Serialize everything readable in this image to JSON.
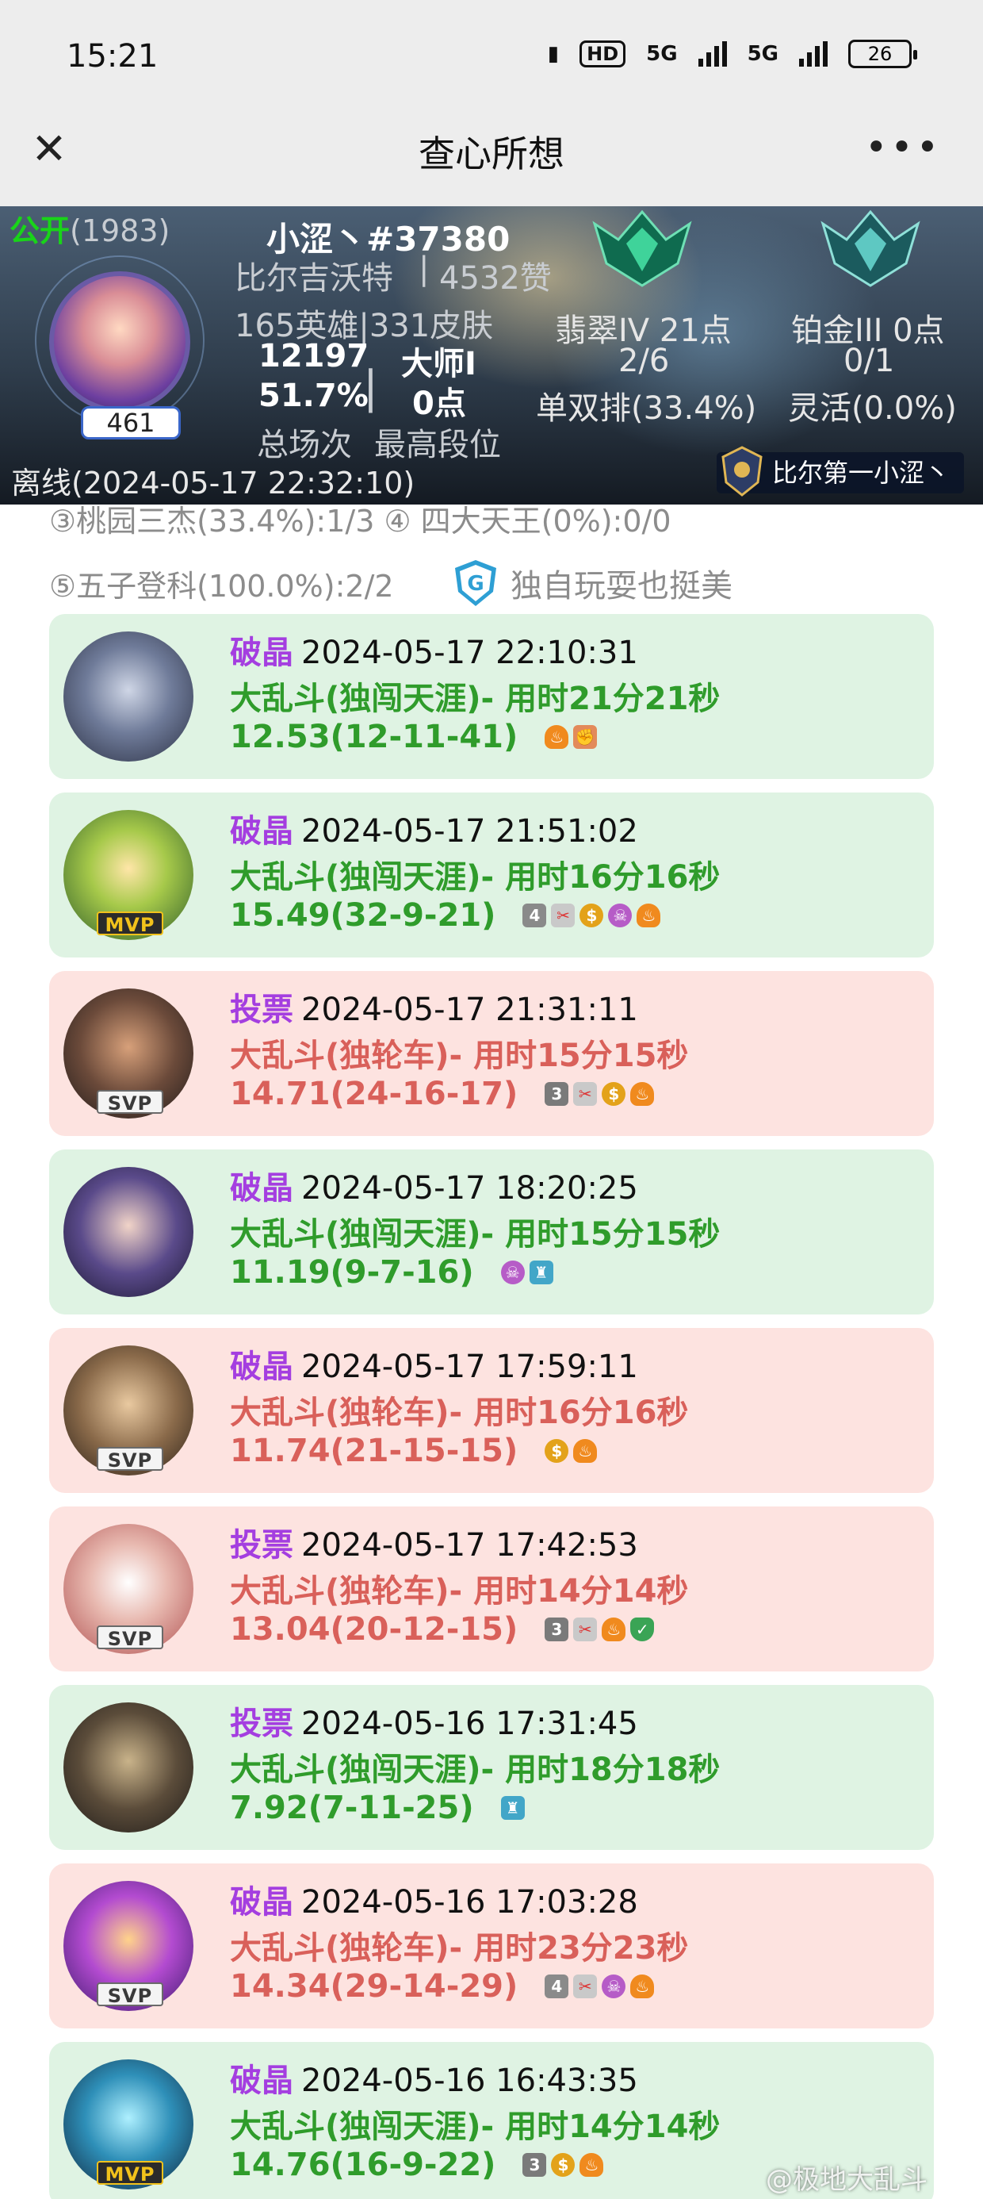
{
  "status_bar": {
    "time": "15:21",
    "icons": [
      "vibrate-icon",
      "hd-icon",
      "signal-5g-icon",
      "signal-5g-icon",
      "battery-icon"
    ],
    "hd_label": "HD",
    "net1": "5G",
    "net2": "5G",
    "battery": "26"
  },
  "title_bar": {
    "title": "查心所想",
    "close_icon": "✕",
    "more_icon": "•••"
  },
  "profile": {
    "visibility": "公开",
    "visibility_count": "(1983)",
    "name": "小涩丶#37380",
    "server": "比尔吉沃特",
    "likes": "4532赞",
    "heroes_skins": "165英雄|331皮肤",
    "total_games": "12197",
    "win_rate": "51.7%",
    "total_games_label": "总场次",
    "highest_rank": "大师I",
    "highest_points": "0点",
    "highest_rank_label": "最高段位",
    "level": "461",
    "solo_rank": "翡翠IV 21点",
    "solo_record": "2/6",
    "solo_label": "单双排(33.4%)",
    "flex_rank": "铂金III 0点",
    "flex_record": "0/1",
    "flex_label": "灵活(0.0%)",
    "status": "离线(2024-05-17 22:32:10)",
    "title_chip": "比尔第一小涩丶"
  },
  "streaks": {
    "row1": "③桃园三杰(33.4%):1/3 ④ 四大天王(0%):0/0",
    "row2": "⑤五子登科(100.0%):2/2",
    "solo_tag": "独自玩耍也挺美",
    "solo_icon": "G"
  },
  "matches": [
    {
      "result": "破晶",
      "time": "2024-05-17 22:10:31",
      "mode": "大乱斗(独闯天涯)- 用时21分21秒",
      "kda": "12.53(12-11-41)",
      "outcome": "win",
      "badge": "",
      "icons": [
        "fire",
        "fist"
      ]
    },
    {
      "result": "破晶",
      "time": "2024-05-17 21:51:02",
      "mode": "大乱斗(独闯天涯)- 用时16分16秒",
      "kda": "15.49(32-9-21)",
      "outcome": "win",
      "badge": "MVP",
      "icons": [
        "four",
        "sword",
        "coin",
        "skull",
        "fire"
      ]
    },
    {
      "result": "投票",
      "time": "2024-05-17 21:31:11",
      "mode": "大乱斗(独轮车)- 用时15分15秒",
      "kda": "14.71(24-16-17)",
      "outcome": "loss",
      "badge": "SVP",
      "icons": [
        "three",
        "sword",
        "coin",
        "fire"
      ]
    },
    {
      "result": "破晶",
      "time": "2024-05-17 18:20:25",
      "mode": "大乱斗(独闯天涯)- 用时15分15秒",
      "kda": "11.19(9-7-16)",
      "outcome": "win",
      "badge": "",
      "icons": [
        "skull",
        "tower"
      ]
    },
    {
      "result": "破晶",
      "time": "2024-05-17 17:59:11",
      "mode": "大乱斗(独轮车)- 用时16分16秒",
      "kda": "11.74(21-15-15)",
      "outcome": "loss",
      "badge": "SVP",
      "icons": [
        "coin",
        "fire"
      ]
    },
    {
      "result": "投票",
      "time": "2024-05-17 17:42:53",
      "mode": "大乱斗(独轮车)- 用时14分14秒",
      "kda": "13.04(20-12-15)",
      "outcome": "loss",
      "badge": "SVP",
      "icons": [
        "three",
        "sword",
        "fire",
        "shield"
      ]
    },
    {
      "result": "投票",
      "time": "2024-05-16 17:31:45",
      "mode": "大乱斗(独闯天涯)- 用时18分18秒",
      "kda": "7.92(7-11-25)",
      "outcome": "win",
      "badge": "",
      "icons": [
        "tower"
      ]
    },
    {
      "result": "破晶",
      "time": "2024-05-16 17:03:28",
      "mode": "大乱斗(独轮车)- 用时23分23秒",
      "kda": "14.34(29-14-29)",
      "outcome": "loss",
      "badge": "SVP",
      "icons": [
        "four",
        "sword",
        "skull",
        "fire"
      ]
    },
    {
      "result": "破晶",
      "time": "2024-05-16 16:43:35",
      "mode": "大乱斗(独闯天涯)- 用时14分14秒",
      "kda": "14.76(16-9-22)",
      "outcome": "win",
      "badge": "MVP",
      "icons": [
        "three",
        "coin",
        "fire"
      ]
    }
  ],
  "watermark": "@极地大乱斗",
  "colors": {
    "win_bg": "#dff3e3",
    "loss_bg": "#fde3e0",
    "win_text": "#2f9c2b",
    "loss_text": "#d9605a",
    "result_purple": "#a43ee0",
    "public_green": "#19d419"
  }
}
